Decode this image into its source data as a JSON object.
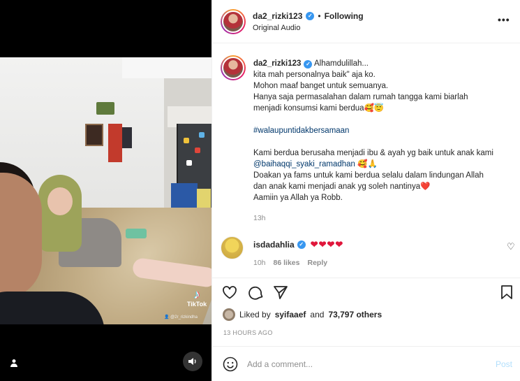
{
  "header": {
    "username": "da2_rizki123",
    "separator": "•",
    "follow_label": "Following",
    "subtitle": "Original Audio",
    "more_label": "•••"
  },
  "caption": {
    "username": "da2_rizki123",
    "lines": [
      "Alhamdulillah...",
      "kita mah personalnya baik\" aja ko.",
      "Mohon maaf banget untuk semuanya.",
      "Hanya saja permasalahan dalam rumah tangga kami biarlah",
      "menjadi konsumsi kami berdua🥰😇"
    ],
    "hashtag": "#walaupuntidakbersamaan",
    "lines2": [
      "Kami berdua berusaha menjadi ibu & ayah yg baik untuk anak kami"
    ],
    "mention": "@baihaqqi_syaki_ramadhan",
    "mention_suffix": " 🥰🙏",
    "lines3": [
      "Doakan ya fams untuk kami berdua selalu dalam lindungan Allah",
      "dan anak kami menjadi anak yg soleh nantinya❤️",
      "Aamiin ya Allah ya Robb."
    ],
    "time": "13h"
  },
  "comment": {
    "username": "isdadahlia",
    "text": "❤❤❤❤",
    "time": "10h",
    "likes": "86 likes",
    "reply_label": "Reply"
  },
  "video": {
    "tiktok_label": "TikTok",
    "tiktok_user": "👤 @2r_rizkindha"
  },
  "likes": {
    "prefix": "Liked by",
    "user": "syifaaef",
    "middle": "and",
    "count": "73,797 others"
  },
  "posted": "13 HOURS AGO",
  "comment_box": {
    "placeholder": "Add a comment...",
    "post_label": "Post"
  },
  "icons": {
    "like": "heart-outline-icon",
    "comment": "comment-icon",
    "share": "share-icon",
    "save": "bookmark-icon",
    "emoji": "emoji-icon",
    "sound": "speaker-icon",
    "user_tag": "person-icon"
  },
  "colors": {
    "verified": "#3897f0",
    "link": "#00376b",
    "heart": "#e0163b",
    "post_disabled": "#b2dffc"
  }
}
